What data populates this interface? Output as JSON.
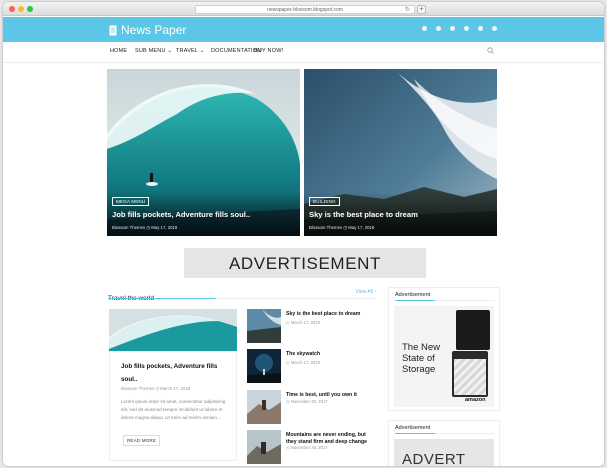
{
  "browser": {
    "url": "newspaper-blossom.blogspot.com",
    "reload_icon": "reload-icon"
  },
  "site": {
    "title": "News Paper",
    "logo_icon": "document-icon",
    "accent": "#5bc6e5",
    "social_icons": [
      "instagram-icon",
      "pinterest-icon",
      "youtube-icon",
      "google-plus-icon",
      "twitter-icon",
      "facebook-icon"
    ]
  },
  "nav": {
    "items": [
      "HOME",
      "SUB MENU",
      "TRAVEL",
      "DOCUMENTATION",
      "BUY NOW!"
    ],
    "search_icon": "search-icon"
  },
  "hero": [
    {
      "badge": "MEGA MENU",
      "title": "Job fills pockets, Adventure fills soul..",
      "meta": "Blossom Themes   ◷ May 17, 2018"
    },
    {
      "badge": "BUILDING",
      "title": "Sky is the best place to dream",
      "meta": "Blossom Themes   ◷ May 17, 2018"
    }
  ],
  "advertisement": {
    "text": "ADVERTISEMENT"
  },
  "section": {
    "title": "Travel the world",
    "view_all": "View All ›",
    "featured": {
      "title": "Job fills pockets, Adventure fills soul..",
      "meta": "Blossom Themes   ◷ March 17, 2018",
      "excerpt": "Lorem ipsum dolor sit amet, consectetur adipisicing elit, sed do eiusmod tempor incididunt ut labore et dolore magna aliqua. Ut enim ad minim veniam...",
      "button": "READ MORE"
    },
    "list": [
      {
        "title": "Sky is the best place to dream",
        "meta": "◷ March 17, 2018"
      },
      {
        "title": "The skywatch",
        "meta": "◷ March 17, 2018"
      },
      {
        "title": "Time is best, until you own it",
        "meta": "◷ November 30, 2017"
      },
      {
        "title": "Mountains are never ending, but they stand firm and deep change",
        "meta": "◷ November 30, 2017"
      }
    ]
  },
  "sidebar": {
    "widgets": [
      {
        "title": "Advertisement",
        "ad_line1": "The New",
        "ad_line2": "State of",
        "ad_line3": "Storage",
        "ad_brand": "amazon"
      },
      {
        "title": "Advertisement",
        "ad_text": "ADVERT"
      }
    ]
  }
}
